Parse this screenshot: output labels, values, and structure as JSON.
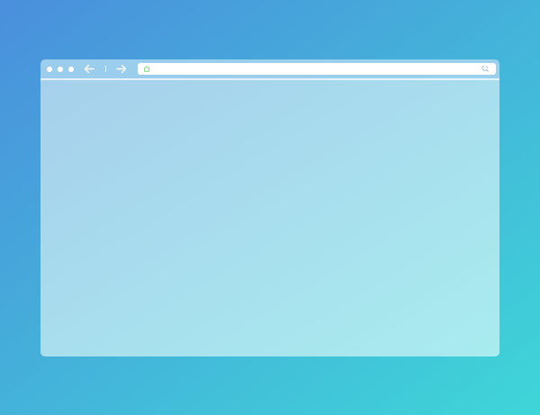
{
  "colors": {
    "background_gradient_start": "#4a8fdc",
    "background_gradient_end": "#3ed6d8",
    "window_frame": "#ffffff",
    "address_bar": "#ffffff",
    "home_icon": "#7dd87a",
    "search_icon": "#a9c3d6",
    "toolbar_icons": "#ffffff"
  },
  "window": {
    "controls": [
      {
        "name": "window-dot-1"
      },
      {
        "name": "window-dot-2"
      },
      {
        "name": "window-dot-3"
      }
    ],
    "icons": {
      "back": "arrow-left-icon",
      "forward": "arrow-right-icon",
      "home": "home-icon",
      "search": "search-icon",
      "download": "arrow-down-icon",
      "menu": "hamburger-menu-icon"
    }
  },
  "address_bar": {
    "url": ""
  }
}
